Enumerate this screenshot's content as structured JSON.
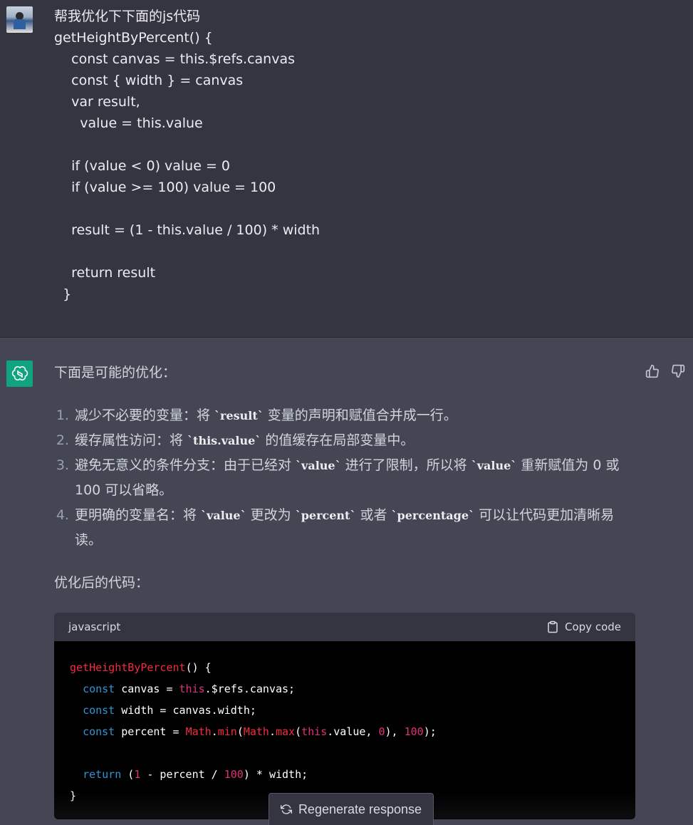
{
  "user": {
    "lines": [
      "帮我优化下下面的js代码",
      "getHeightByPercent() {",
      "    const canvas = this.$refs.canvas",
      "    const { width } = canvas",
      "    var result,",
      "      value = this.value",
      "",
      "    if (value < 0) value = 0",
      "    if (value >= 100) value = 100",
      "",
      "    result = (1 - this.value / 100) * width",
      "",
      "    return result",
      "  }"
    ]
  },
  "assistant": {
    "intro": "下面是可能的优化：",
    "points": [
      {
        "pre": "减少不必要的变量：将 ",
        "code": "result",
        "post": " 变量的声明和赋值合并成一行。",
        "code2": "",
        "post2": "",
        "code3": "",
        "post3": ""
      },
      {
        "pre": "缓存属性访问：将 ",
        "code": "this.value",
        "post": " 的值缓存在局部变量中。",
        "code2": "",
        "post2": "",
        "code3": "",
        "post3": ""
      },
      {
        "pre": "避免无意义的条件分支：由于已经对 ",
        "code": "value",
        "post": " 进行了限制，所以将 ",
        "code2": "value",
        "post2": " 重新赋值为 0 或 100 可以省略。",
        "code3": "",
        "post3": ""
      },
      {
        "pre": "更明确的变量名：将 ",
        "code": "value",
        "post": " 更改为 ",
        "code2": "percent",
        "post2": " 或者 ",
        "code3": "percentage",
        "post3": " 可以让代码更加清晰易读。"
      }
    ],
    "after_title": "优化后的代码："
  },
  "code_block": {
    "language": "javascript",
    "copy_label": "Copy code",
    "lines": [
      [
        {
          "t": "getHeightByPercent",
          "c": "fn"
        },
        {
          "t": "() {",
          "c": ""
        }
      ],
      [
        {
          "t": "  ",
          "c": ""
        },
        {
          "t": "const",
          "c": "kw"
        },
        {
          "t": " canvas = ",
          "c": ""
        },
        {
          "t": "this",
          "c": "this"
        },
        {
          "t": ".$refs.canvas;",
          "c": ""
        }
      ],
      [
        {
          "t": "  ",
          "c": ""
        },
        {
          "t": "const",
          "c": "kw"
        },
        {
          "t": " width = canvas.width;",
          "c": ""
        }
      ],
      [
        {
          "t": "  ",
          "c": ""
        },
        {
          "t": "const",
          "c": "kw"
        },
        {
          "t": " percent = ",
          "c": ""
        },
        {
          "t": "Math",
          "c": "fn"
        },
        {
          "t": ".",
          "c": ""
        },
        {
          "t": "min",
          "c": "fn"
        },
        {
          "t": "(",
          "c": ""
        },
        {
          "t": "Math",
          "c": "fn"
        },
        {
          "t": ".",
          "c": ""
        },
        {
          "t": "max",
          "c": "fn"
        },
        {
          "t": "(",
          "c": ""
        },
        {
          "t": "this",
          "c": "this"
        },
        {
          "t": ".value, ",
          "c": ""
        },
        {
          "t": "0",
          "c": "num"
        },
        {
          "t": "), ",
          "c": ""
        },
        {
          "t": "100",
          "c": "num"
        },
        {
          "t": ");",
          "c": ""
        }
      ],
      [],
      [
        {
          "t": "  ",
          "c": ""
        },
        {
          "t": "return",
          "c": "kw"
        },
        {
          "t": " (",
          "c": ""
        },
        {
          "t": "1",
          "c": "num"
        },
        {
          "t": " - percent / ",
          "c": ""
        },
        {
          "t": "100",
          "c": "num"
        },
        {
          "t": ") * width;",
          "c": ""
        }
      ],
      [
        {
          "t": "}",
          "c": ""
        }
      ]
    ]
  },
  "regenerate_label": "Regenerate response",
  "colors": {
    "accent": "#10a37f",
    "user_bg": "#343541",
    "assistant_bg": "#444654"
  },
  "icons": {
    "thumb_up": "thumbs-up-icon",
    "thumb_down": "thumbs-down-icon",
    "copy": "clipboard-icon",
    "regen": "refresh-icon",
    "openai": "openai-logo-icon"
  }
}
